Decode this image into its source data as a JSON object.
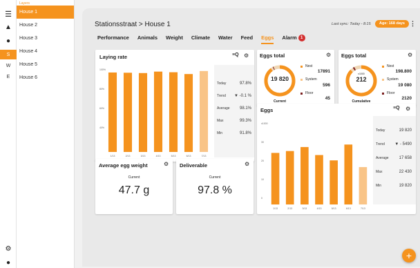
{
  "rail": {
    "letters": [
      "S",
      "W",
      "E"
    ],
    "active_letter": "S"
  },
  "houses": {
    "header": "Layers",
    "items": [
      "House 1",
      "House 2",
      "House 3",
      "House 4",
      "House 5",
      "House 6"
    ],
    "active": "House 1"
  },
  "header": {
    "breadcrumb": "Stationsstraat > House 1",
    "sync": "Last sync: Today - 8:15",
    "age": "Age: 168 days"
  },
  "tabs": [
    {
      "label": "Performance"
    },
    {
      "label": "Animals"
    },
    {
      "label": "Weight"
    },
    {
      "label": "Climate"
    },
    {
      "label": "Water"
    },
    {
      "label": "Feed"
    },
    {
      "label": "Eggs",
      "active": true
    },
    {
      "label": "Alarm",
      "badge": "1"
    }
  ],
  "laying_rate": {
    "title": "Laying rate",
    "stats": [
      {
        "label": "Today",
        "value": "97.8%"
      },
      {
        "label": "Trend",
        "value": "-0.1 %",
        "trend": "down"
      },
      {
        "label": "Average",
        "value": "98.1%"
      },
      {
        "label": "Max",
        "value": "99.3%"
      },
      {
        "label": "Min",
        "value": "91.8%"
      }
    ]
  },
  "eggs_total": {
    "title": "Eggs total",
    "value": "19 820",
    "caption": "Current",
    "legend": [
      {
        "label": "Nest",
        "value": "17891",
        "color": "#f5931e"
      },
      {
        "label": "System",
        "value": "596",
        "color": "#f9c487"
      },
      {
        "label": "Floor",
        "value": "45",
        "color": "#7a1f1f"
      }
    ]
  },
  "eggs_cumulative": {
    "title": "Eggs total",
    "value_small": "x1000",
    "value": "212",
    "caption": "Cumulative",
    "legend": [
      {
        "label": "Nest",
        "value": "198.800",
        "color": "#f5931e"
      },
      {
        "label": "System",
        "value": "19 080",
        "color": "#f9c487"
      },
      {
        "label": "Floor",
        "value": "2120",
        "color": "#7a1f1f"
      }
    ]
  },
  "eggs": {
    "title": "Eggs",
    "stats": [
      {
        "label": "Today",
        "value": "19 820"
      },
      {
        "label": "Trend",
        "value": "- 5490",
        "trend": "down"
      },
      {
        "label": "Average",
        "value": "17 658"
      },
      {
        "label": "Max",
        "value": "22 430"
      },
      {
        "label": "Min",
        "value": "19 820"
      }
    ]
  },
  "avg_egg_weight": {
    "title": "Average egg weight",
    "caption": "Current",
    "value": "47.7 g"
  },
  "deliverable": {
    "title": "Deliverable",
    "caption": "Current",
    "value": "97.8 %"
  },
  "colors": {
    "accent": "#f5931e",
    "accent_light": "#f9c487",
    "alarm": "#d32f2f"
  },
  "chart_data": [
    {
      "type": "bar",
      "name": "laying-rate",
      "categories": [
        "1/13",
        "2/13",
        "3/13",
        "4/13",
        "5/13",
        "6/13",
        "7/13"
      ],
      "values": [
        97.5,
        97.2,
        96.8,
        98.6,
        97.8,
        95.6,
        99.3
      ],
      "highlight_last": true,
      "ylim": [
        0,
        100
      ],
      "yticks": [
        "100%",
        "80%",
        "60%",
        "40%"
      ]
    },
    {
      "type": "bar",
      "name": "eggs",
      "categories": [
        "1/13",
        "2/13",
        "3/13",
        "4/13",
        "5/13",
        "6/13",
        "7/13"
      ],
      "values": [
        19300,
        20000,
        21500,
        18500,
        16500,
        22430,
        14000
      ],
      "highlight_last": true,
      "ylim": [
        0,
        30000
      ],
      "yticks": [
        "x1000",
        "30",
        "20",
        "10",
        "0"
      ]
    }
  ]
}
